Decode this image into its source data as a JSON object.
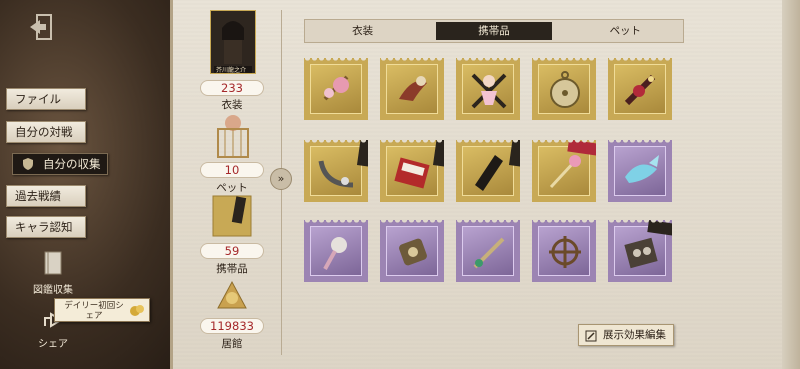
{
  "menu": {
    "items": [
      {
        "label": "ファイル"
      },
      {
        "label": "自分の対戦"
      },
      {
        "label": "自分の収集"
      },
      {
        "label": "過去戦績"
      },
      {
        "label": "キャラ認知"
      }
    ]
  },
  "tools": {
    "codex_label": "図鑑収集",
    "share_label": "シェア",
    "daily_tip": "デイリー初回シェア"
  },
  "character_card": {
    "name": "芥川龍之介"
  },
  "stats": [
    {
      "value": "233",
      "label": "衣装"
    },
    {
      "value": "10",
      "label": "ペット"
    },
    {
      "value": "59",
      "label": "携帯品"
    },
    {
      "value": "119833",
      "label": "居館"
    }
  ],
  "tabs": [
    {
      "label": "衣装"
    },
    {
      "label": "携帯品"
    },
    {
      "label": "ペット"
    }
  ],
  "selected_tab": "携帯品",
  "items": [
    {
      "name": "gold-item-flamingo",
      "rarity": "gold"
    },
    {
      "name": "gold-item-bird",
      "rarity": "gold"
    },
    {
      "name": "gold-item-doll",
      "rarity": "gold"
    },
    {
      "name": "gold-item-clock",
      "rarity": "gold"
    },
    {
      "name": "gold-item-gem",
      "rarity": "gold"
    },
    {
      "name": "gold-item-chain",
      "rarity": "gold"
    },
    {
      "name": "gold-item-box",
      "rarity": "gold"
    },
    {
      "name": "gold-item-belt",
      "rarity": "gold"
    },
    {
      "name": "gold-item-wand",
      "rarity": "gold"
    },
    {
      "name": "purple-item-whale",
      "rarity": "purple"
    },
    {
      "name": "purple-item-tool",
      "rarity": "purple"
    },
    {
      "name": "purple-item-ring",
      "rarity": "purple"
    },
    {
      "name": "purple-item-sword",
      "rarity": "purple"
    },
    {
      "name": "purple-item-wheel",
      "rarity": "purple"
    },
    {
      "name": "purple-item-device",
      "rarity": "purple"
    }
  ],
  "edit_button": {
    "label": "展示効果編集"
  },
  "colors": {
    "accent_red": "#a5282a",
    "gold": "#c8a955",
    "purple": "#9c84b3",
    "dark": "#2a241d"
  }
}
